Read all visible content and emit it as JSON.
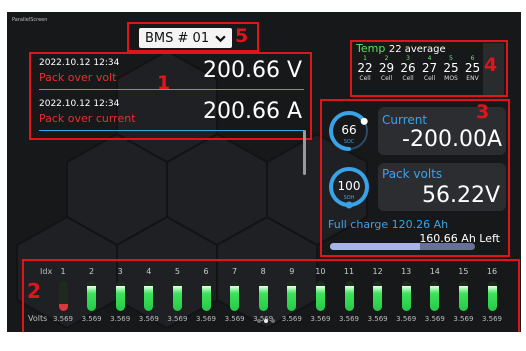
{
  "app_title": "ParallelScreen",
  "callouts": [
    "1",
    "2",
    "3",
    "4",
    "5"
  ],
  "bms_selector": {
    "label": "BMS # 01"
  },
  "alarms": [
    {
      "timestamp": "2022.10.12 12:34",
      "message": "Pack over volt",
      "value": "200.66 V"
    },
    {
      "timestamp": "2022.10.12 12:34",
      "message": "Pack over current",
      "value": "200.66 A"
    }
  ],
  "temperature": {
    "label": "Temp",
    "average": "22 average",
    "sensors": [
      {
        "idx": "1",
        "value": "22",
        "type": "Cell"
      },
      {
        "idx": "2",
        "value": "29",
        "type": "Cell"
      },
      {
        "idx": "3",
        "value": "26",
        "type": "Cell"
      },
      {
        "idx": "4",
        "value": "27",
        "type": "Cell"
      },
      {
        "idx": "5",
        "value": "25",
        "type": "MOS"
      },
      {
        "idx": "6",
        "value": "25",
        "type": "ENV"
      }
    ]
  },
  "soc": {
    "value": "66",
    "label": "SOC",
    "level": 0.66
  },
  "soh": {
    "value": "100",
    "label": "SOH",
    "level": 1.0
  },
  "current": {
    "label": "Current",
    "value": "-200.00A"
  },
  "pack_volts": {
    "label": "Pack volts",
    "value": "56.22V"
  },
  "charge": {
    "full_label": "Full charge 120.26 Ah",
    "left": "160.66 Ah Left",
    "level": 0.62
  },
  "cells": {
    "idx_label": "Idx",
    "volts_label": "Volts",
    "items": [
      {
        "idx": "1",
        "volts": "3.569",
        "level": 0.15,
        "alarm": true
      },
      {
        "idx": "2",
        "volts": "3.569",
        "level": 0.85,
        "alarm": false
      },
      {
        "idx": "3",
        "volts": "3.569",
        "level": 0.85,
        "alarm": false
      },
      {
        "idx": "4",
        "volts": "3.569",
        "level": 0.85,
        "alarm": false
      },
      {
        "idx": "5",
        "volts": "3.569",
        "level": 0.85,
        "alarm": false
      },
      {
        "idx": "6",
        "volts": "3.569",
        "level": 0.85,
        "alarm": false
      },
      {
        "idx": "7",
        "volts": "3.569",
        "level": 0.85,
        "alarm": false
      },
      {
        "idx": "8",
        "volts": "3.569",
        "level": 0.85,
        "alarm": false
      },
      {
        "idx": "9",
        "volts": "3.569",
        "level": 0.85,
        "alarm": false
      },
      {
        "idx": "10",
        "volts": "3.569",
        "level": 0.85,
        "alarm": false
      },
      {
        "idx": "11",
        "volts": "3.569",
        "level": 0.85,
        "alarm": false
      },
      {
        "idx": "12",
        "volts": "3.569",
        "level": 0.85,
        "alarm": false
      },
      {
        "idx": "13",
        "volts": "3.569",
        "level": 0.85,
        "alarm": false
      },
      {
        "idx": "14",
        "volts": "3.569",
        "level": 0.85,
        "alarm": false
      },
      {
        "idx": "15",
        "volts": "3.569",
        "level": 0.85,
        "alarm": false
      },
      {
        "idx": "16",
        "volts": "3.569",
        "level": 0.85,
        "alarm": false
      }
    ]
  },
  "colors": {
    "accent": "#3aa3e8",
    "alarm": "#e63030",
    "callout": "#e0141b",
    "cell_ok": "#3be35a",
    "temp_label": "#5fe05f"
  },
  "page_indicator": {
    "count": 3,
    "active": 1
  }
}
